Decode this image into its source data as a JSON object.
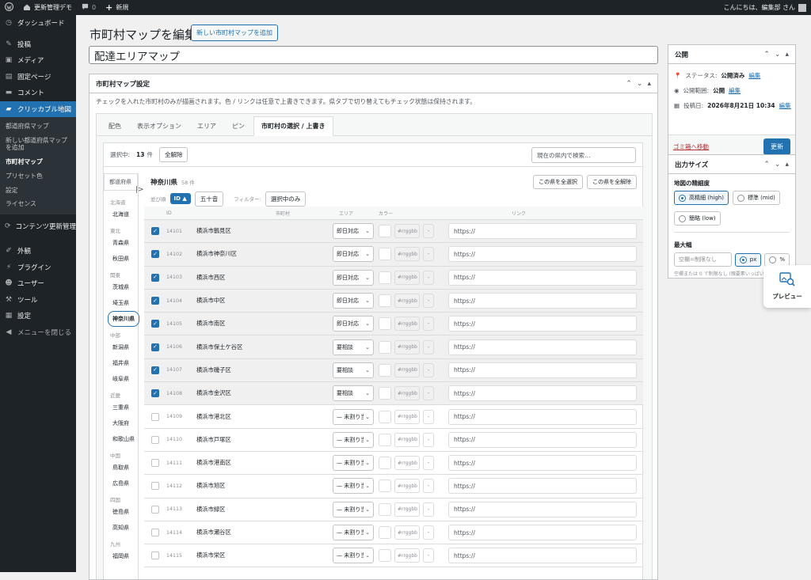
{
  "adminbar": {
    "site_name": "更新管理デモ",
    "comments_count": "0",
    "new_label": "新規",
    "greeting": "こんにちは、編集部 さん"
  },
  "sidebar": {
    "items_top": [
      {
        "icon": "dashboard",
        "label": "ダッシュボード"
      }
    ],
    "items_mid": [
      {
        "icon": "pin",
        "label": "投稿"
      },
      {
        "icon": "media",
        "label": "メディア"
      },
      {
        "icon": "page",
        "label": "固定ページ"
      },
      {
        "icon": "comment",
        "label": "コメント"
      }
    ],
    "current": {
      "icon": "map",
      "label": "クリッカブル地図"
    },
    "submenu": [
      "都道府県マップ",
      "新しい都道府県マップを追加",
      "市町村マップ",
      "プリセット色",
      "設定",
      "ライセンス"
    ],
    "submenu_current_index": 2,
    "items_after": [
      {
        "icon": "update",
        "label": "コンテンツ更新管理"
      }
    ],
    "items_bottom": [
      {
        "icon": "appearance",
        "label": "外観"
      },
      {
        "icon": "plugin",
        "label": "プラグイン"
      },
      {
        "icon": "users",
        "label": "ユーザー"
      },
      {
        "icon": "tools",
        "label": "ツール"
      },
      {
        "icon": "settings",
        "label": "設定"
      }
    ],
    "collapse_label": "メニューを閉じる"
  },
  "page": {
    "title": "市町村マップを編集",
    "add_new": "新しい市町村マップを追加",
    "post_title": "配達エリアマップ"
  },
  "settings_box": {
    "title": "市町村マップ設定",
    "description": "チェックを入れた市町村のみが描画されます。色 / リンクは任意で上書きできます。県タブで切り替えてもチェック状態は保持されます。",
    "tabs": [
      "配色",
      "表示オプション",
      "エリア",
      "ピン",
      "市町村の選択 / 上書き"
    ],
    "active_tab": 4,
    "selected_label": "選択中:",
    "selected_count": "13",
    "selected_unit": "件",
    "clear_all": "全解除",
    "search_placeholder": "現在の県内で検索…"
  },
  "prefectures": {
    "header": "都道府県",
    "groups": [
      {
        "region": "北海道",
        "items": [
          "北海道"
        ]
      },
      {
        "region": "東北",
        "items": [
          "青森県",
          "秋田県"
        ]
      },
      {
        "region": "関東",
        "items": [
          "茨城県",
          "埼玉県",
          "神奈川県"
        ]
      },
      {
        "region": "中部",
        "items": [
          "新潟県",
          "福井県",
          "岐阜県"
        ]
      },
      {
        "region": "近畿",
        "items": [
          "三重県",
          "大阪府",
          "和歌山県"
        ]
      },
      {
        "region": "中国",
        "items": [
          "鳥取県",
          "広島県"
        ]
      },
      {
        "region": "四国",
        "items": [
          "徳島県",
          "高知県"
        ]
      },
      {
        "region": "九州",
        "items": [
          "福岡県"
        ]
      }
    ],
    "active": "神奈川県"
  },
  "city_list": {
    "pref_name": "神奈川県",
    "count": "58 件",
    "select_all": "この県を全選択",
    "deselect_all": "この県を全解除",
    "sort_label": "並び順",
    "sort_id": "ID ▲",
    "sort_kana": "五十音",
    "filter_label": "フィルター:",
    "filter_selected": "選択中のみ",
    "columns": {
      "id": "ID",
      "city": "市町村",
      "area": "エリア",
      "color": "カラー",
      "link": "リンク"
    },
    "color_placeholder": "#rrggbb",
    "minus": "-",
    "link_placeholder": "https://",
    "rows": [
      {
        "checked": true,
        "id": "14101",
        "name": "横浜市鶴見区",
        "area": "即日対応"
      },
      {
        "checked": true,
        "id": "14102",
        "name": "横浜市神奈川区",
        "area": "即日対応"
      },
      {
        "checked": true,
        "id": "14103",
        "name": "横浜市西区",
        "area": "即日対応"
      },
      {
        "checked": true,
        "id": "14104",
        "name": "横浜市中区",
        "area": "即日対応"
      },
      {
        "checked": true,
        "id": "14105",
        "name": "横浜市南区",
        "area": "即日対応"
      },
      {
        "checked": true,
        "id": "14106",
        "name": "横浜市保土ケ谷区",
        "area": "要相談"
      },
      {
        "checked": true,
        "id": "14107",
        "name": "横浜市磯子区",
        "area": "要相談"
      },
      {
        "checked": true,
        "id": "14108",
        "name": "横浜市金沢区",
        "area": "要相談"
      },
      {
        "checked": false,
        "id": "14109",
        "name": "横浜市港北区",
        "area": "— 未割り当て —"
      },
      {
        "checked": false,
        "id": "14110",
        "name": "横浜市戸塚区",
        "area": "— 未割り当て —"
      },
      {
        "checked": false,
        "id": "14111",
        "name": "横浜市港南区",
        "area": "— 未割り当て —"
      },
      {
        "checked": false,
        "id": "14112",
        "name": "横浜市旭区",
        "area": "— 未割り当て —"
      },
      {
        "checked": false,
        "id": "14113",
        "name": "横浜市緑区",
        "area": "— 未割り当て —"
      },
      {
        "checked": false,
        "id": "14114",
        "name": "横浜市瀬谷区",
        "area": "— 未割り当て —"
      },
      {
        "checked": false,
        "id": "14115",
        "name": "横浜市栄区",
        "area": "— 未割り当て —"
      }
    ]
  },
  "publish": {
    "title": "公開",
    "status_label": "ステータス:",
    "status_value": "公開済み",
    "visibility_label": "公開範囲:",
    "visibility_value": "公開",
    "date_label": "投稿日:",
    "date_value": "2026年8月21日 10:34",
    "edit": "編集",
    "trash": "ゴミ箱へ移動",
    "update": "更新"
  },
  "output": {
    "title": "出力サイズ",
    "precision_label": "地図の精細度",
    "precision_options": [
      "高精細 (high)",
      "標準 (mid)",
      "簡略 (low)"
    ],
    "precision_selected": 0,
    "maxwidth_label": "最大幅",
    "maxwidth_placeholder": "空欄=制限なし",
    "unit_options": [
      "px",
      "%"
    ],
    "unit_selected": 0,
    "hint": "空欄または 0 で制限なし (親要素いっぱいに伸びます)"
  },
  "preview": {
    "label": "プレビュー"
  },
  "colors": {
    "accent": "#2271b1",
    "adminbar": "#1d2327",
    "trash": "#b32d2e"
  }
}
